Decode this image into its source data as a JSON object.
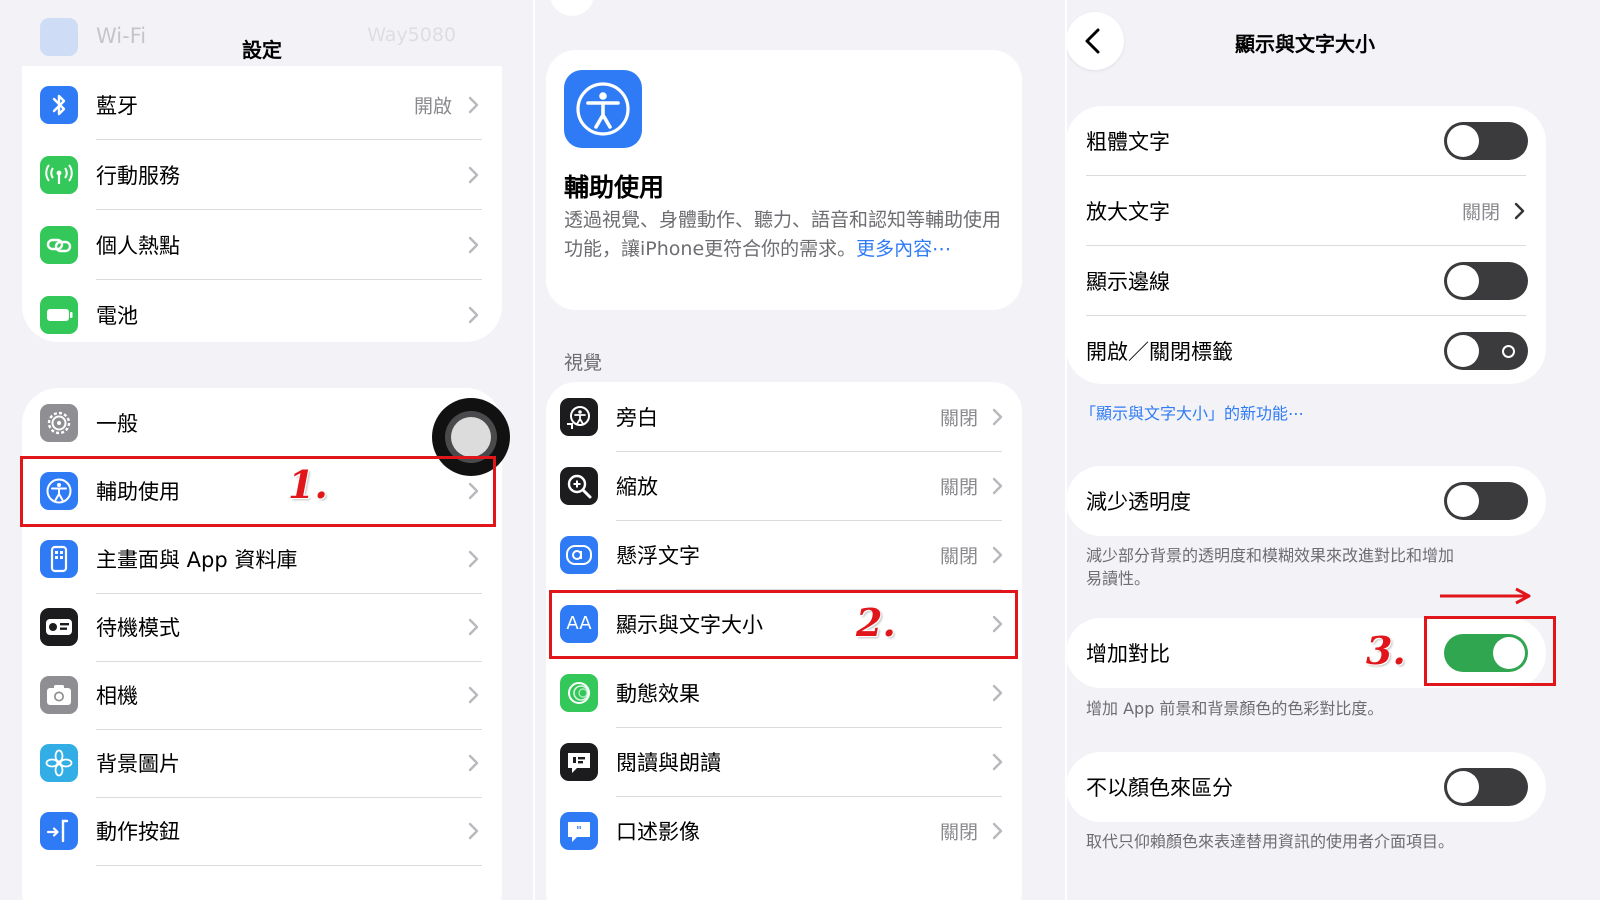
{
  "settings": {
    "title": "設定",
    "wifi": {
      "label": "Wi-Fi",
      "value": "Way5080"
    },
    "group1": [
      {
        "label": "藍牙",
        "value": "開啟",
        "icon": "bluetooth-icon"
      },
      {
        "label": "行動服務",
        "value": "",
        "icon": "cellular-icon"
      },
      {
        "label": "個人熱點",
        "value": "",
        "icon": "hotspot-icon"
      },
      {
        "label": "電池",
        "value": "",
        "icon": "battery-icon"
      }
    ],
    "group2": [
      {
        "label": "一般",
        "icon": "gear-icon"
      },
      {
        "label": "輔助使用",
        "icon": "accessibility-icon"
      },
      {
        "label": "主畫面與 App 資料庫",
        "icon": "home-screen-icon"
      },
      {
        "label": "待機模式",
        "icon": "standby-icon"
      },
      {
        "label": "相機",
        "icon": "camera-icon"
      },
      {
        "label": "背景圖片",
        "icon": "wallpaper-icon"
      },
      {
        "label": "動作按鈕",
        "icon": "action-button-icon"
      }
    ],
    "step_label": "1."
  },
  "accessibility": {
    "title": "輔助使用",
    "description": "透過視覺、身體動作、聽力、語音和認知等輔助使用功能，讓iPhone更符合你的需求。",
    "more_link": "更多內容⋯",
    "section_vision": "視覺",
    "rows": [
      {
        "label": "旁白",
        "value": "關閉",
        "icon": "voiceover-icon"
      },
      {
        "label": "縮放",
        "value": "關閉",
        "icon": "zoom-icon"
      },
      {
        "label": "懸浮文字",
        "value": "關閉",
        "icon": "hover-text-icon"
      },
      {
        "label": "顯示與文字大小",
        "value": "",
        "icon": "text-size-icon",
        "icon_text": "AA"
      },
      {
        "label": "動態效果",
        "value": "",
        "icon": "motion-icon"
      },
      {
        "label": "閱讀與朗讀",
        "value": "",
        "icon": "spoken-content-icon"
      },
      {
        "label": "口述影像",
        "value": "關閉",
        "icon": "audio-description-icon"
      }
    ],
    "step_label": "2."
  },
  "display": {
    "title": "顯示與文字大小",
    "group1": [
      {
        "label": "粗體文字",
        "type": "toggle",
        "on": false
      },
      {
        "label": "放大文字",
        "type": "link",
        "value": "關閉"
      },
      {
        "label": "顯示邊線",
        "type": "toggle",
        "on": false
      },
      {
        "label": "開啟／關閉標籤",
        "type": "toggle",
        "on": false
      }
    ],
    "new_features_link": "「顯示與文字大小」的新功能⋯",
    "reduce_transparency": {
      "label": "減少透明度",
      "on": false,
      "caption": "減少部分背景的透明度和模糊效果來改進對比和增加易讀性。"
    },
    "increase_contrast": {
      "label": "增加對比",
      "on": true,
      "caption": "增加 App 前景和背景顏色的色彩對比度。"
    },
    "differentiate": {
      "label": "不以顏色來區分",
      "on": false,
      "caption": "取代只仰賴顏色來表達替用資訊的使用者介面項目。"
    },
    "step_label": "3."
  },
  "colors": {
    "annotation": "#e0161b",
    "toggle_on": "#30a650",
    "toggle_off": "#3b3b3e",
    "link": "#2f7bf6"
  }
}
